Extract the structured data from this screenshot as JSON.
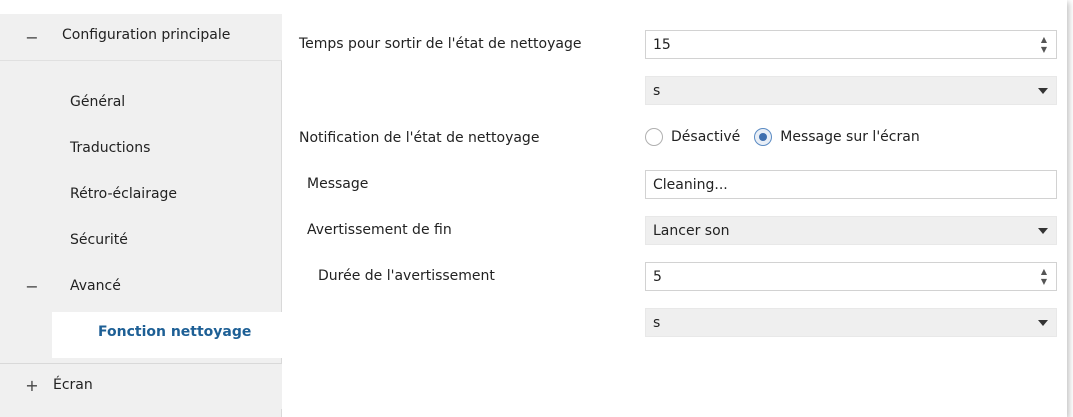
{
  "sidebar": {
    "groups": [
      {
        "toggle": "−",
        "label": "Configuration principale"
      }
    ],
    "items": [
      {
        "label": "Général"
      },
      {
        "label": "Traductions"
      },
      {
        "label": "Rétro-éclairage"
      },
      {
        "label": "Sécurité"
      }
    ],
    "subgroup": {
      "toggle": "−",
      "label": "Avancé"
    },
    "selected_item": {
      "label": "Fonction nettoyage"
    },
    "bottom_group": {
      "toggle": "+",
      "label": "Écran"
    },
    "colors": {
      "selected_text": "#1d5f95",
      "background": "#f0f0f0"
    }
  },
  "main": {
    "time_to_exit": {
      "label": "Temps pour sortir de l'état de nettoyage",
      "value": "15",
      "unit": "s"
    },
    "notification": {
      "label": "Notification de l'état de nettoyage",
      "options": [
        "Désactivé",
        "Message sur l'écran"
      ],
      "selected": "Message sur l'écran"
    },
    "message": {
      "label": "Message",
      "value": "Cleaning..."
    },
    "end_warning": {
      "label": "Avertissement de fin",
      "value": "Lancer son"
    },
    "warning_duration": {
      "label": "Durée de l'avertissement",
      "value": "5",
      "unit": "s"
    }
  }
}
